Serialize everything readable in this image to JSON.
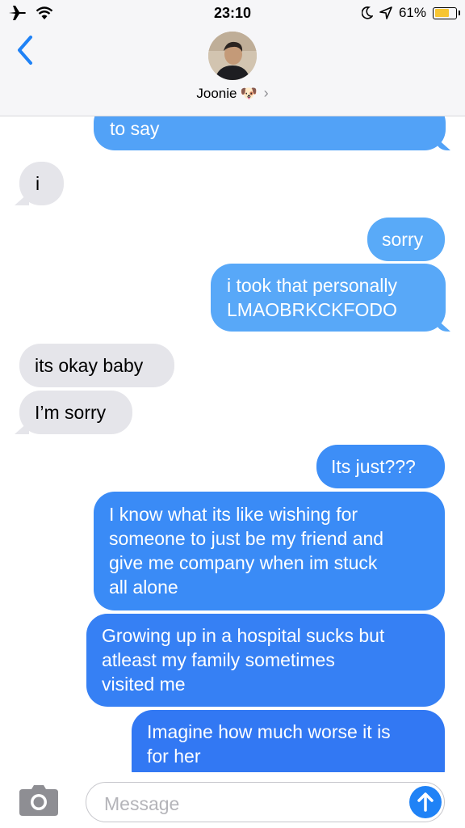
{
  "status_bar": {
    "time": "23:10",
    "battery_percent_label": "61%",
    "battery_level": 0.61,
    "battery_color": "#f7c531",
    "icons": [
      "airplane-icon",
      "wifi-icon",
      "moon-icon",
      "location-arrow-icon",
      "battery-icon"
    ]
  },
  "header": {
    "back_icon": "chevron-left-icon",
    "contact_name": "Joonie",
    "contact_emoji": "🐶",
    "disclosure_icon": "chevron-right-icon"
  },
  "messages": [
    {
      "direction": "outgoing",
      "text": "to say",
      "color": "#52a2f7"
    },
    {
      "direction": "incoming",
      "text": "i"
    },
    {
      "direction": "outgoing",
      "text": "sorry",
      "color": "#59aaf8"
    },
    {
      "direction": "outgoing",
      "text": "i took that personally\nLMAOBRKCKFODO",
      "color": "#58a8f8"
    },
    {
      "direction": "incoming",
      "text": "its okay baby"
    },
    {
      "direction": "incoming",
      "text": "I’m sorry"
    },
    {
      "direction": "outgoing",
      "text": "Its just???",
      "color": "#3d8ef7"
    },
    {
      "direction": "outgoing",
      "text": "I know what its like wishing for\nsomeone to just be my friend and\ngive me company when im stuck\nall alone",
      "color": "#3a8bf6"
    },
    {
      "direction": "outgoing",
      "text": "Growing up in a hospital sucks but\natleast my family sometimes\nvisited me",
      "color": "#3680f4"
    },
    {
      "direction": "outgoing",
      "text": "Imagine how much worse it is\nfor her",
      "color": "#3278f3"
    }
  ],
  "input_bar": {
    "camera_icon": "camera-icon",
    "placeholder": "Message",
    "send_icon": "arrow-up-icon",
    "send_color": "#1f82f6"
  },
  "colors": {
    "accent": "#1f82f6",
    "incoming_bubble": "#e5e5ea",
    "header_bg": "#f6f6f8"
  }
}
